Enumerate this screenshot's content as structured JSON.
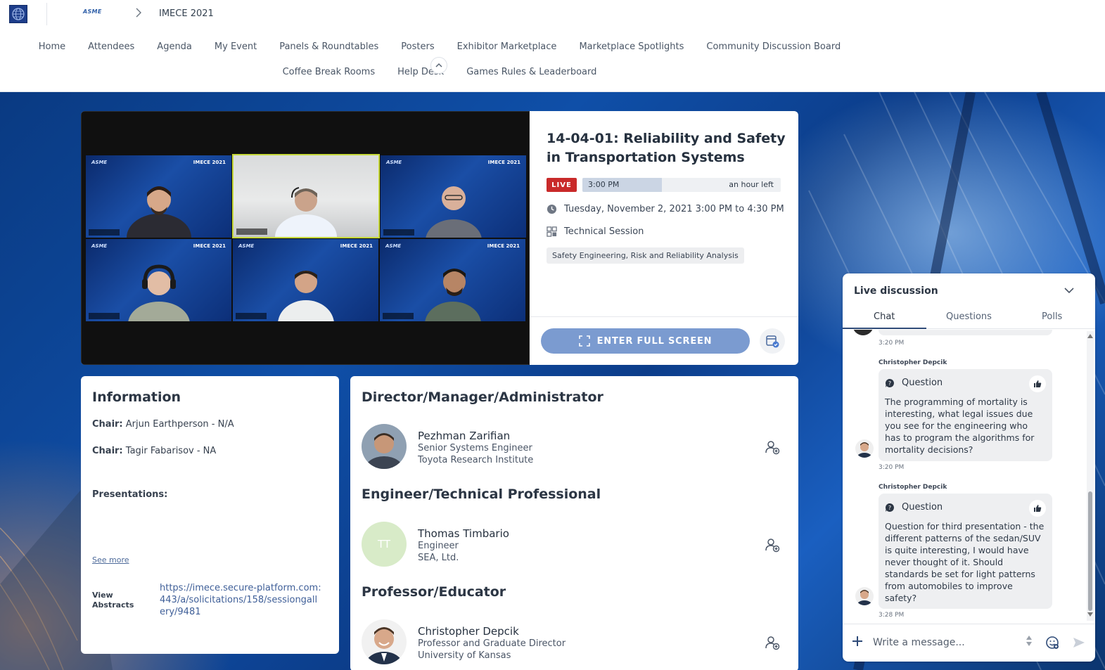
{
  "header": {
    "org_logo": "globe-logo",
    "asme_logo_text": "ASME",
    "breadcrumb_separator": "chevron-right-icon",
    "event_title": "IMECE 2021"
  },
  "nav": {
    "row1": [
      "Home",
      "Attendees",
      "Agenda",
      "My Event",
      "Panels & Roundtables",
      "Posters",
      "Exhibitor Marketplace",
      "Marketplace Spotlights",
      "Community Discussion Board"
    ],
    "row2": [
      "Coffee Break Rooms",
      "Help Desk",
      "Games Rules & Leaderboard"
    ]
  },
  "video": {
    "tile_brand_left": "ASME",
    "tile_brand_right": "IMECE 2021"
  },
  "session": {
    "title": "14-04-01: Reliability and Safety in Transportation Systems",
    "live_label": "LIVE",
    "start_time": "3:00 PM",
    "time_left": "an hour left",
    "elapsed_fraction": 0.4,
    "datetime": "Tuesday, November 2, 2021 3:00 PM to 4:30 PM",
    "type": "Technical Session",
    "tag": "Safety Engineering, Risk and Reliability Analysis",
    "fullscreen_label": "ENTER FULL SCREEN"
  },
  "information": {
    "title": "Information",
    "chair_label": "Chair:",
    "chair1": "Arjun Earthperson - N/A",
    "chair2": "Tagir Fabarisov - NA",
    "presentations_label": "Presentations:",
    "see_more": "See more",
    "abstracts_label": "View Abstracts",
    "abstracts_link": "https://imece.secure-platform.com:443/a/solicitations/158/sessiongallery/9481"
  },
  "speakers": {
    "groups": [
      {
        "title": "Director/Manager/Administrator",
        "name": "Pezhman Zarifian",
        "role": "Senior Systems Engineer",
        "org": "Toyota Research Institute"
      },
      {
        "title": "Engineer/Technical Professional",
        "name": "Thomas Timbario",
        "role": "Engineer",
        "org": "SEA, Ltd.",
        "initials": "TT"
      },
      {
        "title": "Professor/Educator",
        "name": "Christopher Depcik",
        "role": "Professor and Graduate Director",
        "org": "University of Kansas"
      }
    ]
  },
  "discussion": {
    "title": "Live discussion",
    "tabs": [
      "Chat",
      "Questions",
      "Polls"
    ],
    "active_tab": "Chat",
    "messages": [
      {
        "time": "3:20 PM"
      },
      {
        "author": "Christopher Depcik",
        "label": "Question",
        "text": "The programming of mortality is interesting, what legal issues due you see for the engineering who has to program the algorithms for mortality decisions?",
        "time": "3:20 PM"
      },
      {
        "author": "Christopher Depcik",
        "label": "Question",
        "text": "Question for third presentation - the different patterns of the sedan/SUV is quite interesting, I would have never thought of it. Should standards be set for light patterns from automobiles to improve safety?",
        "time": "3:28 PM"
      }
    ],
    "composer_placeholder": "Write a message..."
  },
  "colors": {
    "accent": "#7b9bd0",
    "live": "#c92a2a",
    "link": "#3f5f98"
  }
}
